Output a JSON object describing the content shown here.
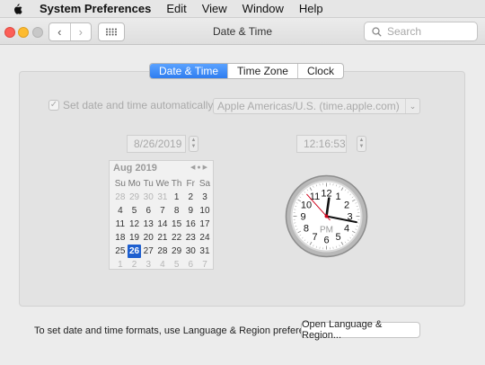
{
  "menubar": {
    "app_name": "System Preferences",
    "items": [
      "Edit",
      "View",
      "Window",
      "Help"
    ]
  },
  "window": {
    "title": "Date & Time",
    "search_placeholder": "Search"
  },
  "tabs": [
    {
      "label": "Date & Time",
      "active": true
    },
    {
      "label": "Time Zone",
      "active": false
    },
    {
      "label": "Clock",
      "active": false
    }
  ],
  "auto": {
    "label": "Set date and time automatically:",
    "checked": true,
    "server": "Apple Americas/U.S. (time.apple.com)"
  },
  "date_field": "8/26/2019",
  "time_field": "12:16:53",
  "calendar": {
    "month_label": "Aug 2019",
    "weekdays": [
      "Su",
      "Mo",
      "Tu",
      "We",
      "Th",
      "Fr",
      "Sa"
    ],
    "days": [
      [
        "28",
        "29",
        "30",
        "31",
        "1",
        "2",
        "3"
      ],
      [
        "4",
        "5",
        "6",
        "7",
        "8",
        "9",
        "10"
      ],
      [
        "11",
        "12",
        "13",
        "14",
        "15",
        "16",
        "17"
      ],
      [
        "18",
        "19",
        "20",
        "21",
        "22",
        "23",
        "24"
      ],
      [
        "25",
        "26",
        "27",
        "28",
        "29",
        "30",
        "31"
      ],
      [
        "1",
        "2",
        "3",
        "4",
        "5",
        "6",
        "7"
      ]
    ],
    "selected": "26"
  },
  "clock": {
    "numbers": [
      "12",
      "1",
      "2",
      "3",
      "4",
      "5",
      "6",
      "7",
      "8",
      "9",
      "10",
      "11"
    ],
    "meridiem": "PM",
    "hours": 12,
    "minutes": 16,
    "seconds": 53
  },
  "footer": {
    "text": "To set date and time formats, use Language & Region preferences.",
    "button_label": "Open Language & Region..."
  }
}
